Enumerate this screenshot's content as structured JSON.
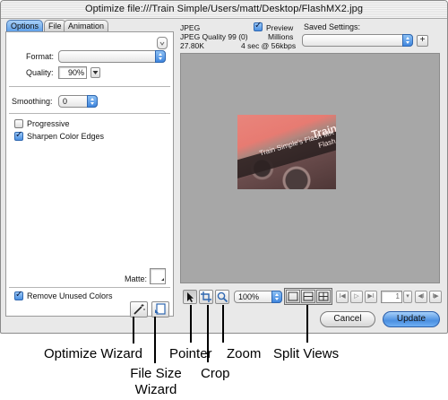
{
  "window": {
    "title": "Optimize file:///Train Simple/Users/matt/Desktop/FlashMX2.jpg"
  },
  "tabs": [
    {
      "label": "Options",
      "active": true
    },
    {
      "label": "File",
      "active": false
    },
    {
      "label": "Animation",
      "active": false
    }
  ],
  "options": {
    "format_label": "Format:",
    "format_value": "",
    "quality_label": "Quality:",
    "quality_value": "90%",
    "smoothing_label": "Smoothing:",
    "smoothing_value": "0",
    "progressive_label": "Progressive",
    "progressive_checked": false,
    "sharpen_label": "Sharpen Color Edges",
    "sharpen_checked": true,
    "matte_label": "Matte:",
    "remove_unused_label": "Remove Unused Colors",
    "remove_unused_checked": true
  },
  "preview_info": {
    "format": "JPEG",
    "quality": "JPEG Quality 99 (0)",
    "size": "27.80K",
    "preview_label": "Preview",
    "preview_checked": true,
    "colors": "Millions",
    "download": "4 sec @ 56kbps"
  },
  "saved_settings": {
    "label": "Saved Settings:",
    "value": "",
    "add_label": "+"
  },
  "preview_image": {
    "line_text": "Train Simple's Flash MX Up-To-Speed",
    "brand_text": "Train Sim",
    "brand_text2": "Flash M"
  },
  "toolbar": {
    "zoom_value": "100%",
    "frame_value": "1"
  },
  "buttons": {
    "cancel": "Cancel",
    "update": "Update"
  },
  "callouts": {
    "optimize_wizard": "Optimize Wizard",
    "file_size_wizard_line1": "File Size",
    "file_size_wizard_line2": "Wizard",
    "pointer": "Pointer",
    "crop": "Crop",
    "zoom": "Zoom",
    "split_views": "Split Views"
  },
  "colors": {
    "accent_blue": "#4b8fe0",
    "preview_bg": "#a7a7a7",
    "window_bg": "#e9e9e9"
  }
}
